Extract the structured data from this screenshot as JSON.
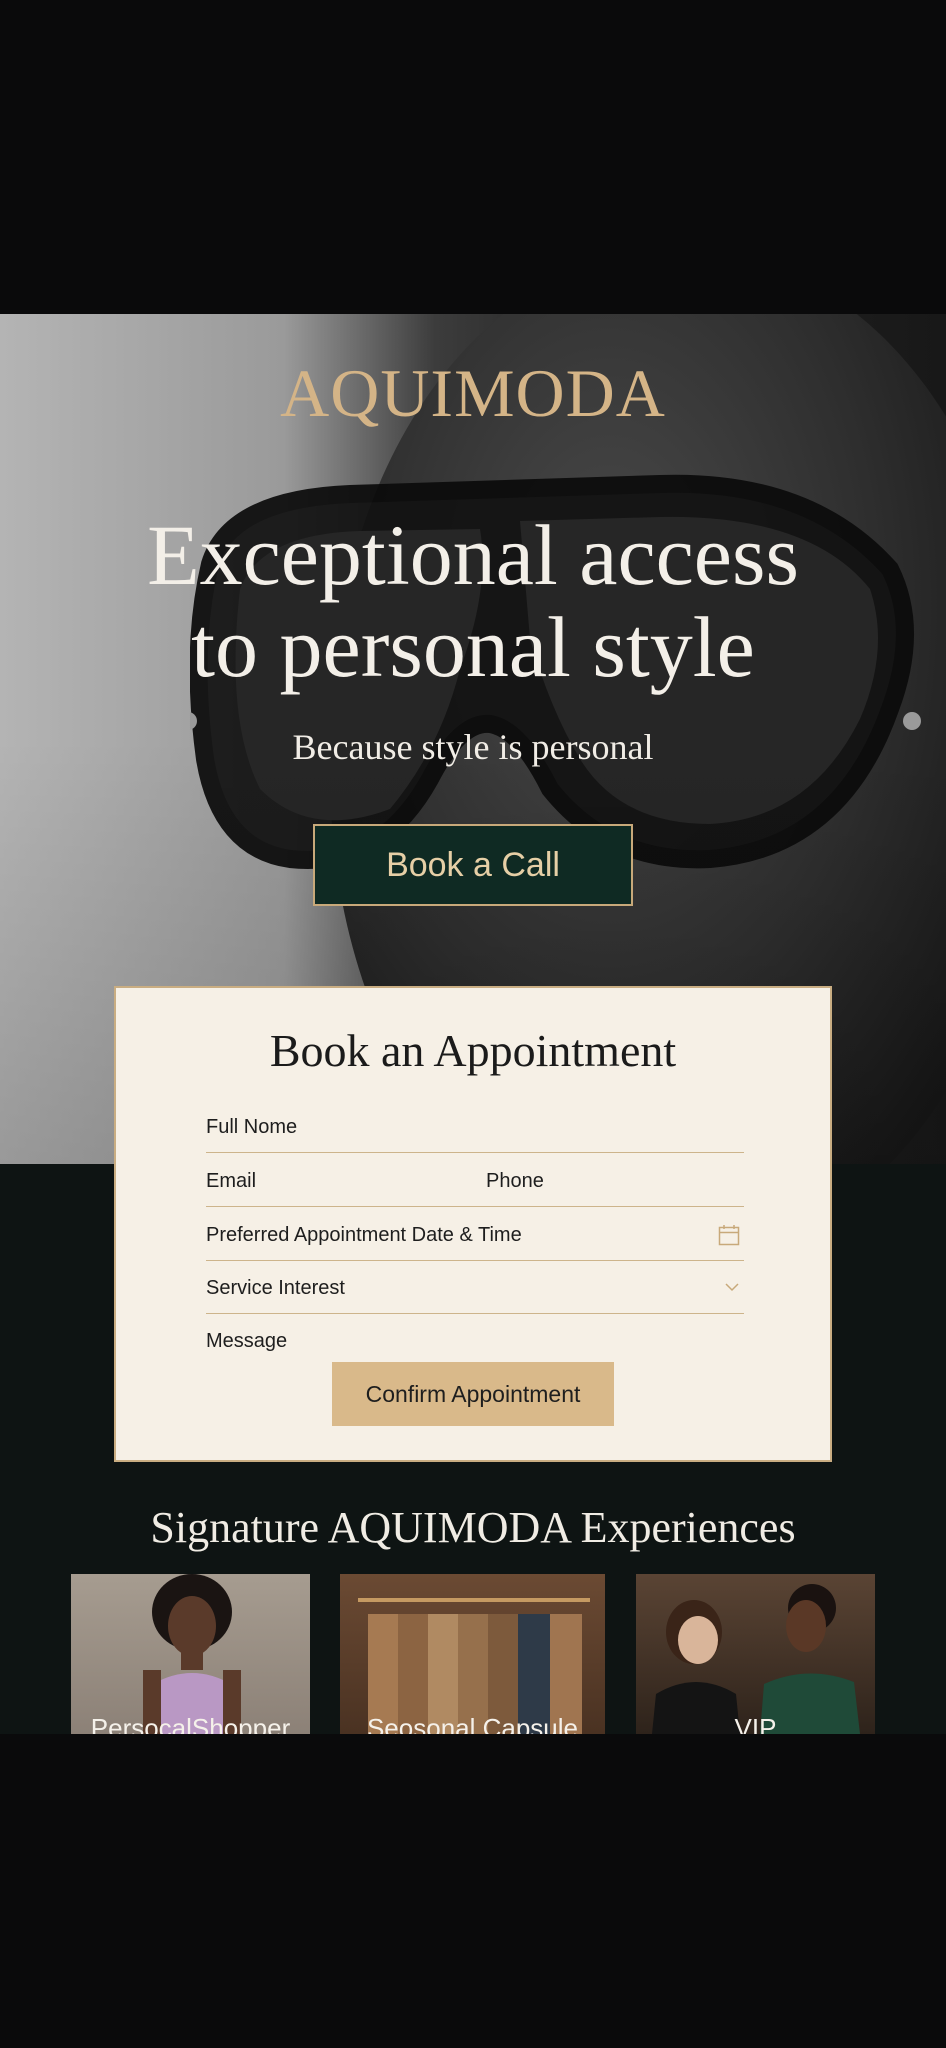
{
  "brand": "AQUIMODA",
  "hero": {
    "headline_line1": "Exceptional access",
    "headline_line2": "to personal style",
    "tagline": "Because style is personal",
    "cta_label": "Book a Call"
  },
  "form": {
    "title": "Book an Appointment",
    "full_name_label": "Full Nome",
    "email_label": "Email",
    "phone_label": "Phone",
    "datetime_label": "Preferred Appointment Date & Time",
    "service_label": "Service Interest",
    "message_label": "Message",
    "submit_label": "Confirm Appointment",
    "icons": {
      "datetime": "calendar-icon",
      "service": "chevron-down-icon"
    }
  },
  "experiences": {
    "title": "Signature AQUIMODA Experiences",
    "items": [
      {
        "label": "PersocalShopper"
      },
      {
        "label": "Seosonal Capsule"
      },
      {
        "label": "VIP"
      }
    ]
  },
  "colors": {
    "accent_gold": "#d4b487",
    "cta_green": "#0f2a23",
    "card_bg": "#f6f0e6",
    "dark_bg": "#0e1413"
  }
}
